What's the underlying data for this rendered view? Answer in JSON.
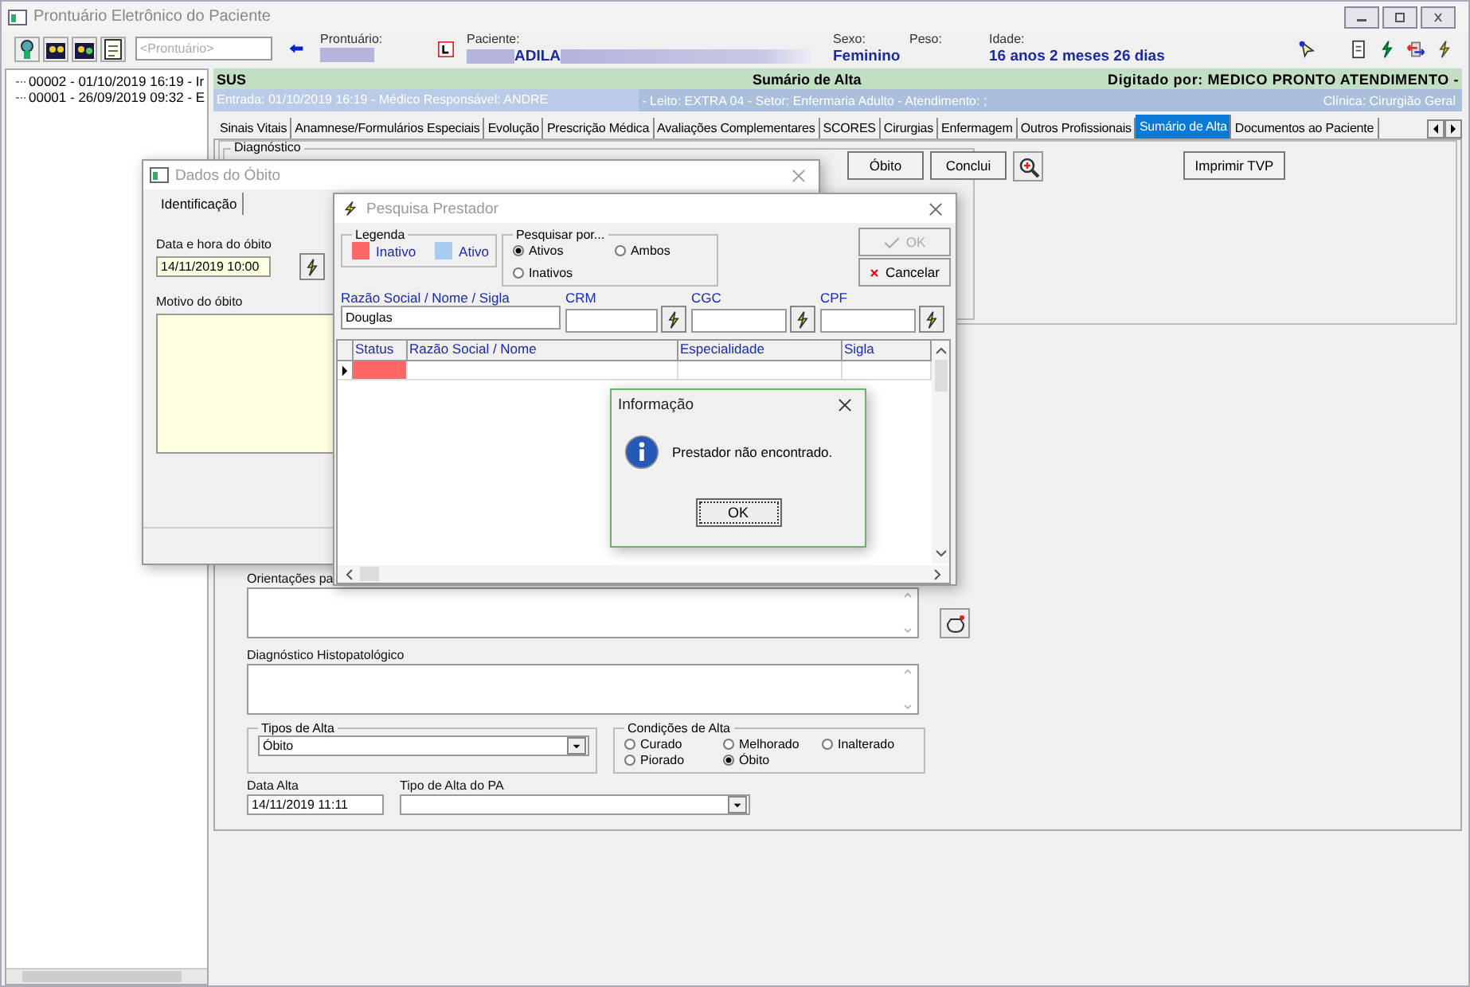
{
  "window": {
    "title": "Prontuário Eletrônico do Paciente"
  },
  "toolbar": {
    "search": {
      "placeholder": "<Prontuário>"
    }
  },
  "header": {
    "record_label": "Prontuário:",
    "patient_label": "Paciente:",
    "patient_name": "ADILA",
    "sex_label": "Sexo:",
    "sex": "Feminino",
    "weight_label": "Peso:",
    "age_label": "Idade:",
    "age": "16 anos 2 meses 26 dias"
  },
  "tree": {
    "items": [
      {
        "label": "00002 - 01/10/2019 16:19 - Ir"
      },
      {
        "label": "00001 - 26/09/2019 09:32 - E"
      }
    ]
  },
  "banner": {
    "left": "SUS",
    "center": "Sumário de Alta",
    "right": "Digitado por: MEDICO PRONTO ATENDIMENTO -"
  },
  "info_bar": {
    "left": "Entrada: 01/10/2019 16:19 - Médico Responsável: ANDRE",
    "middle": "- Leito: EXTRA 04 - Setor: Enfermaria Adulto - Atendimento: ;",
    "right": "Clínica: Cirurgião Geral"
  },
  "tabs": [
    {
      "label": "Sinais Vitais",
      "selected": false
    },
    {
      "label": "Anamnese/Formulários Especiais",
      "selected": false
    },
    {
      "label": "Evolução",
      "selected": false
    },
    {
      "label": "Prescrição Médica",
      "selected": false
    },
    {
      "label": "Avaliações Complementares",
      "selected": false
    },
    {
      "label": "SCORES",
      "selected": false
    },
    {
      "label": "Cirurgias",
      "selected": false
    },
    {
      "label": "Enfermagem",
      "selected": false
    },
    {
      "label": "Outros Profissionais",
      "selected": false
    },
    {
      "label": "Sumário de Alta",
      "selected": true
    },
    {
      "label": "Documentos ao Paciente",
      "selected": false
    }
  ],
  "summary": {
    "diagnosis_legend": "Diagnóstico",
    "buttons": [
      "Óbito",
      "Conclui"
    ],
    "print_button": "Imprimir TVP",
    "orientation_label": "Orientações pa",
    "histopathology_label": "Diagnóstico Histopatológico",
    "discharge_type": {
      "legend": "Tipos de Alta",
      "value": "Óbito"
    },
    "conditions": {
      "legend": "Condições de Alta",
      "options": [
        {
          "label": "Curado",
          "selected": false
        },
        {
          "label": "Melhorado",
          "selected": false
        },
        {
          "label": "Inalterado",
          "selected": false
        },
        {
          "label": "Piorado",
          "selected": false
        },
        {
          "label": "Óbito",
          "selected": true
        }
      ]
    },
    "discharge_date": {
      "label": "Data Alta",
      "value": "14/11/2019 11:11"
    },
    "pa_type": {
      "label": "Tipo de Alta do PA"
    }
  },
  "death_dialog": {
    "title": "Dados do Óbito",
    "tab": "Identificação",
    "datetime_label": "Data e hora do óbito",
    "datetime": "14/11/2019 10:00",
    "reason_label": "Motivo do óbito"
  },
  "search_dialog": {
    "title": "Pesquisa Prestador",
    "legend": {
      "title": "Legenda",
      "items": [
        {
          "label": "Inativo",
          "color": "#ff6666"
        },
        {
          "label": "Ativo",
          "color": "#a9cbef"
        }
      ]
    },
    "search_by": {
      "title": "Pesquisar por...",
      "options": [
        {
          "label": "Ativos",
          "selected": true
        },
        {
          "label": "Ambos",
          "selected": false
        },
        {
          "label": "Inativos",
          "selected": false
        }
      ]
    },
    "ok": {
      "label": "OK",
      "disabled": true
    },
    "cancel": "Cancelar",
    "fields": [
      {
        "label": "Razão Social / Nome / Sigla",
        "value": "Douglas"
      },
      {
        "label": "CRM"
      },
      {
        "label": "CGC"
      },
      {
        "label": "CPF"
      }
    ],
    "grid": {
      "columns": [
        "Status",
        "Razão Social / Nome",
        "Especialidade",
        "Sigla"
      ],
      "rows": [
        {
          "color": "#ff6666",
          "selected": true
        }
      ]
    }
  },
  "message_dialog": {
    "title": "Informação",
    "message": "Prestador não encontrado.",
    "button": "OK"
  }
}
